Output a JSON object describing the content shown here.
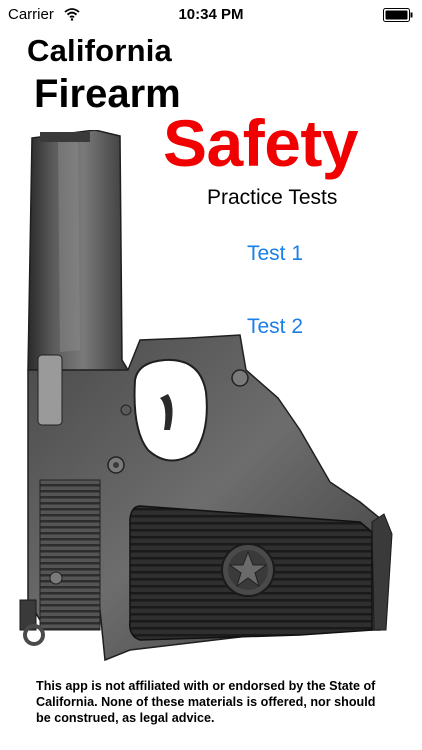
{
  "status_bar": {
    "carrier": "Carrier",
    "time": "10:34 PM",
    "wifi_icon": "wifi-icon",
    "battery_icon": "battery-icon"
  },
  "title": {
    "line1": "California",
    "line2": "Firearm",
    "line3": "Safety",
    "subtitle": "Practice Tests"
  },
  "tests": [
    {
      "label": "Test 1"
    },
    {
      "label": "Test 2"
    }
  ],
  "disclaimer": "This app is not affiliated with or endorsed by the State of California. None of these materials is offered, nor should be construed, as legal advice.",
  "colors": {
    "accent_red": "#f00000",
    "link_blue": "#1a7fe8",
    "background": "#ffffff"
  }
}
